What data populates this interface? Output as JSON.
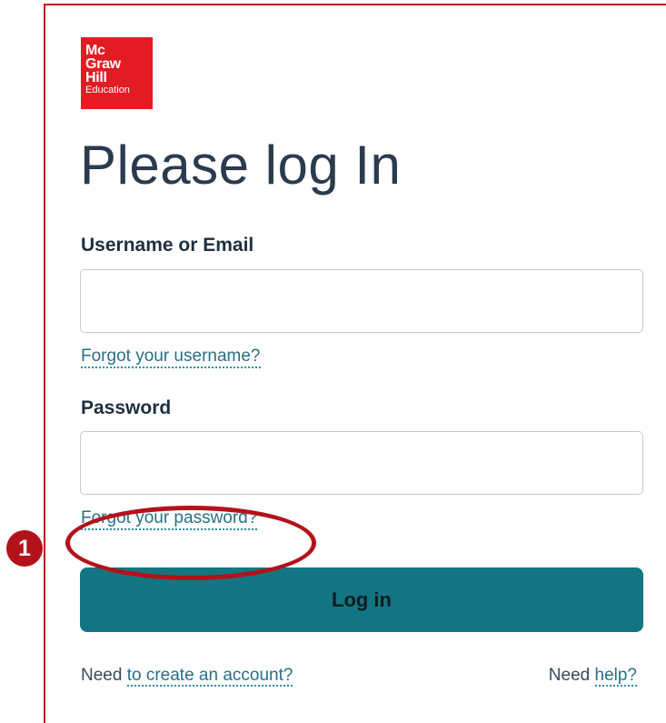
{
  "logo": {
    "lines": [
      "Mc",
      "Graw",
      "Hill",
      "Education"
    ],
    "color": "#e31b23"
  },
  "title": "Please log In",
  "username": {
    "label": "Username or Email",
    "value": "",
    "placeholder": "",
    "forgot_link": "Forgot your username?"
  },
  "password": {
    "label": "Password",
    "value": "",
    "placeholder": "",
    "forgot_link": "Forgot your password?"
  },
  "login_button": {
    "label": "Log in",
    "color": "#137582"
  },
  "footer": {
    "create_prefix": "Need",
    "create_link": "to create an account?",
    "help_prefix": "Need",
    "help_link": "help?"
  },
  "annotation": {
    "badge": "1",
    "color": "#b3121a"
  },
  "colors": {
    "frame": "#c4161c",
    "link": "#2a6f86",
    "title": "#2b3b4e"
  }
}
